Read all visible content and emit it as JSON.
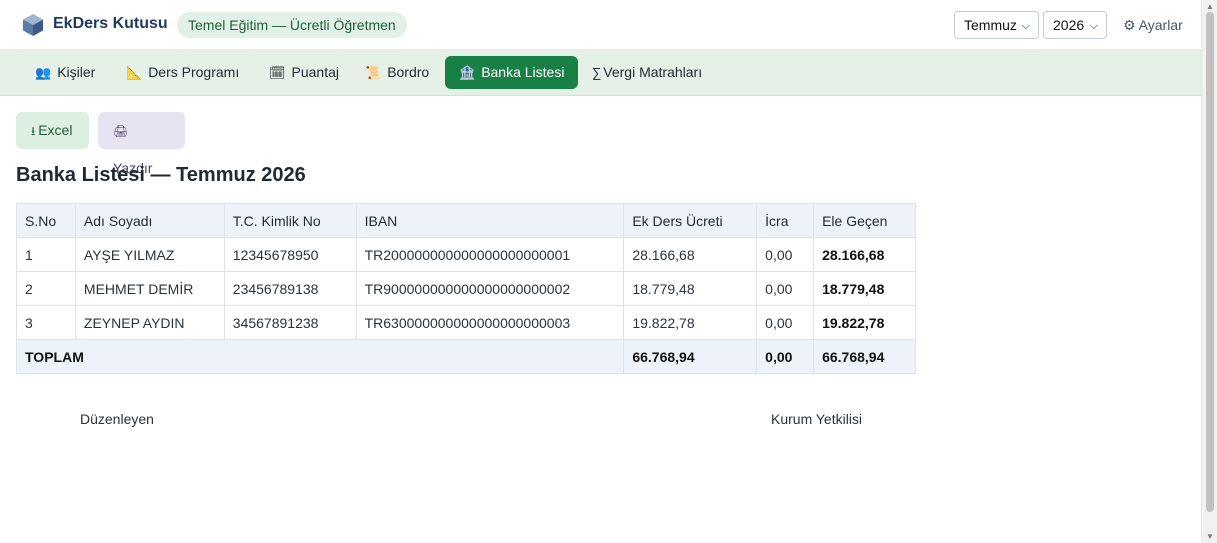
{
  "header": {
    "app_title": "EkDers Kutusu",
    "mode_badge": "Temel Eğitim — Ücretli Öğretmen",
    "month": "Temmuz",
    "year": "2026",
    "settings_label": "⚙ Ayarlar",
    "logo_icon": "cube-logo-icon"
  },
  "nav": {
    "tabs": [
      {
        "icon": "👥",
        "label": "Kişiler"
      },
      {
        "icon": "📐",
        "label": "Ders Programı"
      },
      {
        "icon": "🗓",
        "label": "Puantaj"
      },
      {
        "icon": "📜",
        "label": "Bordro"
      },
      {
        "icon": "🏦",
        "label": "Banka Listesi",
        "active": true
      },
      {
        "icon": "∑",
        "label": "Vergi Matrahları"
      }
    ]
  },
  "actions": {
    "excel_icon": "⭳",
    "excel_label": "Excel",
    "print_icon": "🖨",
    "print_label": "Yazdır"
  },
  "page_title": "Banka Listesi — Temmuz 2026",
  "table": {
    "headers": [
      "S.No",
      "Adı Soyadı",
      "T.C. Kimlik No",
      "IBAN",
      "Ek Ders Ücreti",
      "İcra",
      "Ele Geçen"
    ],
    "rows": [
      [
        "1",
        "AYŞE YILMAZ",
        "12345678950",
        "TR200000000000000000000001",
        "28.166,68",
        "0,00",
        "28.166,68"
      ],
      [
        "2",
        "MEHMET DEMİR",
        "23456789138",
        "TR900000000000000000000002",
        "18.779,48",
        "0,00",
        "18.779,48"
      ],
      [
        "3",
        "ZEYNEP AYDIN",
        "34567891238",
        "TR630000000000000000000003",
        "19.822,78",
        "0,00",
        "19.822,78"
      ]
    ],
    "total": {
      "label": "TOPLAM",
      "ek_ders": "66.768,94",
      "icra": "0,00",
      "ele_gecen": "66.768,94"
    }
  },
  "signatures": {
    "left": "Düzenleyen",
    "right": "Kurum Yetkilisi"
  },
  "colors": {
    "brand": "#1e3a5f",
    "accent": "#198045",
    "nav_bg": "#e5f1e6"
  }
}
